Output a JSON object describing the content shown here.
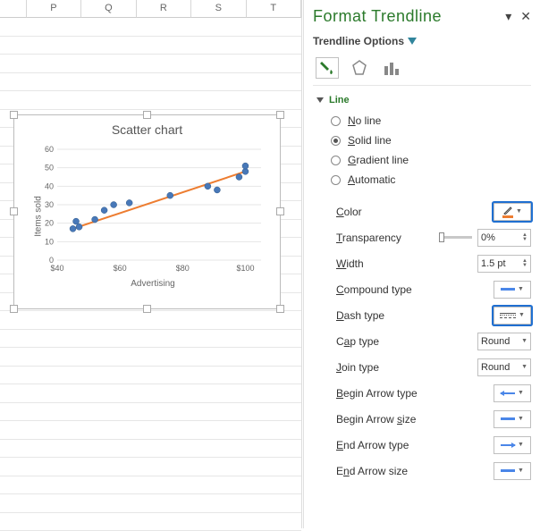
{
  "columns": [
    "P",
    "Q",
    "R",
    "S",
    "T"
  ],
  "chart": {
    "title": "Scatter chart",
    "xlabel": "Advertising",
    "ylabel": "Items sold"
  },
  "chart_data": {
    "type": "scatter",
    "xlabel": "Advertising",
    "ylabel": "Items sold",
    "title": "Scatter chart",
    "xlim": [
      40,
      105
    ],
    "ylim": [
      0,
      60
    ],
    "xticks": [
      "$40",
      "$60",
      "$80",
      "$100"
    ],
    "yticks": [
      0,
      10,
      20,
      30,
      40,
      50,
      60
    ],
    "series": [
      {
        "name": "data",
        "color": "#4878b8",
        "values": [
          [
            45,
            17
          ],
          [
            46,
            21
          ],
          [
            47,
            18
          ],
          [
            52,
            22
          ],
          [
            55,
            27
          ],
          [
            58,
            30
          ],
          [
            63,
            31
          ],
          [
            76,
            35
          ],
          [
            88,
            40
          ],
          [
            91,
            38
          ],
          [
            98,
            45
          ],
          [
            100,
            48
          ],
          [
            100,
            51
          ]
        ]
      },
      {
        "name": "trendline",
        "type": "line",
        "color": "#ed7d31",
        "values": [
          [
            45,
            17
          ],
          [
            100,
            48
          ]
        ]
      }
    ]
  },
  "pane": {
    "title": "Format Trendline",
    "options_label": "Trendline Options",
    "section": "Line",
    "radios": {
      "no_line": "No line",
      "solid_line": "Solid line",
      "gradient_line": "Gradient line",
      "automatic": "Automatic"
    },
    "props": {
      "color": "Color",
      "transparency": "Transparency",
      "transparency_val": "0%",
      "width": "Width",
      "width_val": "1.5 pt",
      "compound": "Compound type",
      "dash": "Dash type",
      "cap": "Cap type",
      "cap_val": "Round",
      "join": "Join type",
      "join_val": "Round",
      "begin_arrow_type": "Begin Arrow type",
      "begin_arrow_size": "Begin Arrow size",
      "end_arrow_type": "End Arrow type",
      "end_arrow_size": "End Arrow size"
    }
  }
}
